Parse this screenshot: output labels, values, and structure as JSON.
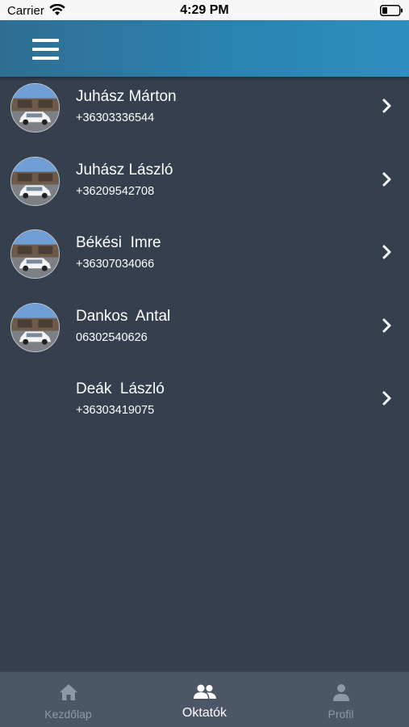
{
  "status_bar": {
    "carrier": "Carrier",
    "time": "4:29 PM"
  },
  "header": {
    "menu_icon": "hamburger-menu-icon"
  },
  "instructors": [
    {
      "name": "Juhász Márton",
      "phone": "+36303336544",
      "has_photo": true
    },
    {
      "name": "Juhász László",
      "phone": "+36209542708",
      "has_photo": true
    },
    {
      "name": "Békési  Imre",
      "phone": "+36307034066",
      "has_photo": true
    },
    {
      "name": "Dankos  Antal",
      "phone": "06302540626",
      "has_photo": true
    },
    {
      "name": "Deák  László",
      "phone": "+36303419075",
      "has_photo": false
    }
  ],
  "tab_bar": {
    "tabs": [
      {
        "label": "Kezdőlap",
        "icon": "home-icon",
        "active": false
      },
      {
        "label": "Oktatók",
        "icon": "people-icon",
        "active": true
      },
      {
        "label": "Profil",
        "icon": "person-icon",
        "active": false
      }
    ]
  },
  "colors": {
    "background": "#353f4d",
    "header_gradient_start": "#2f6e92",
    "header_gradient_end": "#2f8ec0",
    "tab_bar": "#4b5766",
    "tab_inactive": "#8e99a6",
    "tab_active": "#ffffff"
  }
}
